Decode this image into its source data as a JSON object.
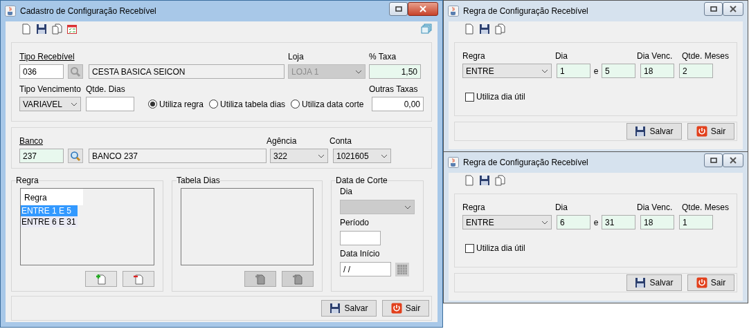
{
  "main": {
    "title": "Cadastro de Configuração Recebível",
    "tipo_recebivel": {
      "label": "Tipo Recebível",
      "code": "036",
      "description": "CESTA BASICA SEICON"
    },
    "loja": {
      "label": "Loja",
      "value": "LOJA 1",
      "disabled": true
    },
    "taxa": {
      "label": "% Taxa",
      "value": "1,50"
    },
    "tipo_vencimento": {
      "label": "Tipo Vencimento",
      "value": "VARIAVEL"
    },
    "qtde_dias": {
      "label": "Qtde. Dias"
    },
    "options": [
      {
        "label": "Utiliza regra",
        "selected": true
      },
      {
        "label": "Utiliza tabela dias",
        "selected": false
      },
      {
        "label": "Utiliza data corte",
        "selected": false
      }
    ],
    "outras_taxas": {
      "label": "Outras Taxas",
      "value": "0,00"
    },
    "banco": {
      "label": "Banco",
      "code": "237",
      "name": "BANCO 237"
    },
    "agencia": {
      "label": "Agência",
      "value": "322"
    },
    "conta": {
      "label": "Conta",
      "value": "1021605"
    },
    "regra": {
      "title": "Regra",
      "header": "Regra",
      "rows": [
        {
          "text": "ENTRE 1 E 5",
          "selected": true
        },
        {
          "text": "ENTRE 6 E 31",
          "selected": false
        }
      ],
      "buttons": [
        {
          "kind": "add",
          "disabled": false
        },
        {
          "kind": "remove",
          "disabled": false
        }
      ]
    },
    "tabela_dias": {
      "title": "Tabela Dias",
      "buttons": [
        {
          "kind": "add",
          "disabled": true
        },
        {
          "kind": "remove",
          "disabled": true
        }
      ]
    },
    "data_corte": {
      "title": "Data de Corte",
      "dia_label": "Dia",
      "dia_disabled": true,
      "periodo_label": "Período",
      "data_inicio_label": "Data Início",
      "data_inicio_value": "/ /"
    },
    "buttons": [
      {
        "label": "Salvar",
        "kind": "save"
      },
      {
        "label": "Sair",
        "kind": "exit"
      }
    ]
  },
  "rule_windows": [
    {
      "title": "Regra de Configuração Recebível",
      "regra_label": "Regra",
      "regra_value": "ENTRE",
      "dia_label": "Dia",
      "dia_from": "1",
      "conjunction": "e",
      "dia_to": "5",
      "dia_venc_label": "Dia Venc.",
      "dia_venc": "18",
      "qtde_label": "Qtde. Meses",
      "qtde": "2",
      "checkbox": {
        "label": "Utiliza dia útil",
        "checked": false
      },
      "buttons": [
        {
          "label": "Salvar",
          "kind": "save"
        },
        {
          "label": "Sair",
          "kind": "exit"
        }
      ]
    },
    {
      "title": "Regra de Configuração Recebível",
      "regra_label": "Regra",
      "regra_value": "ENTRE",
      "dia_label": "Dia",
      "dia_from": "6",
      "conjunction": "e",
      "dia_to": "31",
      "dia_venc_label": "Dia Venc.",
      "dia_venc": "18",
      "qtde_label": "Qtde. Meses",
      "qtde": "1",
      "checkbox": {
        "label": "Utiliza dia útil",
        "checked": false
      },
      "buttons": [
        {
          "label": "Salvar",
          "kind": "save"
        },
        {
          "label": "Sair",
          "kind": "exit"
        }
      ]
    }
  ]
}
